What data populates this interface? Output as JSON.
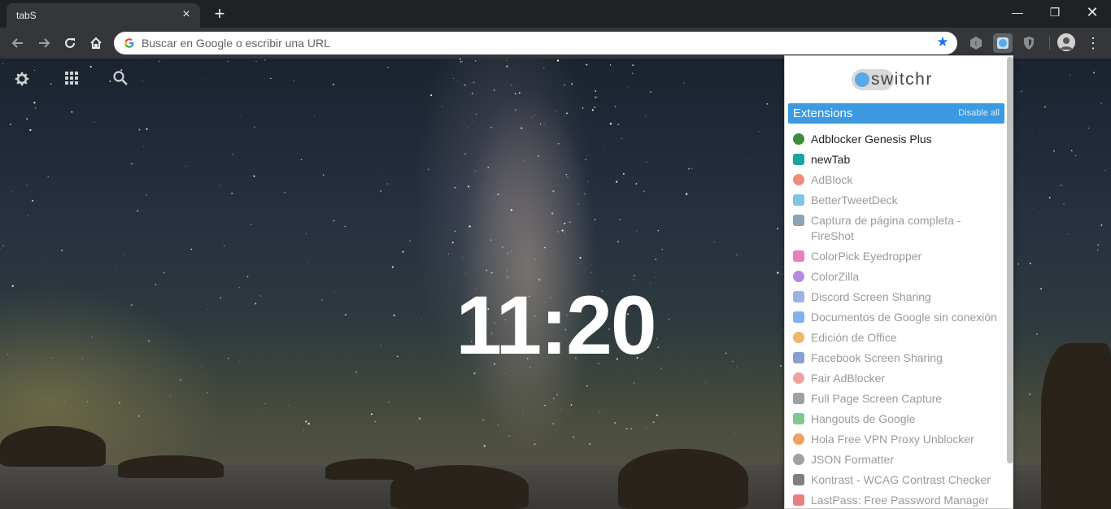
{
  "browser": {
    "tab_title": "tabS",
    "tab_close": "×",
    "new_tab": "+",
    "window": {
      "minimize": "—",
      "maximize": "❐",
      "close": "✕"
    },
    "omnibox_placeholder": "Buscar en Google o escribir una URL"
  },
  "page": {
    "clock": "11:20"
  },
  "popup": {
    "logo_text": "switchr",
    "section_title": "Extensions",
    "disable_all": "Disable all",
    "extensions": [
      {
        "label": "Adblocker Genesis Plus",
        "enabled": true,
        "icon": "shield-icon",
        "color": "#3c8c3c"
      },
      {
        "label": "newTab",
        "enabled": true,
        "icon": "t-badge-icon",
        "color": "#1aa3a3"
      },
      {
        "label": "AdBlock",
        "enabled": false,
        "icon": "stop-sign-icon",
        "color": "#f08a80"
      },
      {
        "label": "BetterTweetDeck",
        "enabled": false,
        "icon": "plus-square-icon",
        "color": "#7fc3e6"
      },
      {
        "label": "Captura de página completa - FireShot",
        "enabled": false,
        "icon": "fireshot-icon",
        "color": "#8aa4b8"
      },
      {
        "label": "ColorPick Eyedropper",
        "enabled": false,
        "icon": "colorpick-icon",
        "color": "#e87fc0"
      },
      {
        "label": "ColorZilla",
        "enabled": false,
        "icon": "colorzilla-icon",
        "color": "#b48ae0"
      },
      {
        "label": "Discord Screen Sharing",
        "enabled": false,
        "icon": "discord-icon",
        "color": "#9fb0e6"
      },
      {
        "label": "Documentos de Google sin conexión",
        "enabled": false,
        "icon": "google-docs-icon",
        "color": "#7fb2f0"
      },
      {
        "label": "Edición de Office",
        "enabled": false,
        "icon": "office-icon",
        "color": "#f0b46a"
      },
      {
        "label": "Facebook Screen Sharing",
        "enabled": false,
        "icon": "facebook-icon",
        "color": "#8a9fcf"
      },
      {
        "label": "Fair AdBlocker",
        "enabled": false,
        "icon": "fair-adblocker-icon",
        "color": "#f0a0a0"
      },
      {
        "label": "Full Page Screen Capture",
        "enabled": false,
        "icon": "camera-icon",
        "color": "#a0a0a0"
      },
      {
        "label": "Hangouts de Google",
        "enabled": false,
        "icon": "hangouts-icon",
        "color": "#7fc890"
      },
      {
        "label": "Hola Free VPN Proxy Unblocker",
        "enabled": false,
        "icon": "hola-icon",
        "color": "#f0a060"
      },
      {
        "label": "JSON Formatter",
        "enabled": false,
        "icon": "json-icon",
        "color": "#a0a0a0"
      },
      {
        "label": "Kontrast - WCAG Contrast Checker",
        "enabled": false,
        "icon": "kontrast-icon",
        "color": "#808080"
      },
      {
        "label": "LastPass: Free Password Manager",
        "enabled": false,
        "icon": "lastpass-icon",
        "color": "#e88080"
      }
    ]
  }
}
